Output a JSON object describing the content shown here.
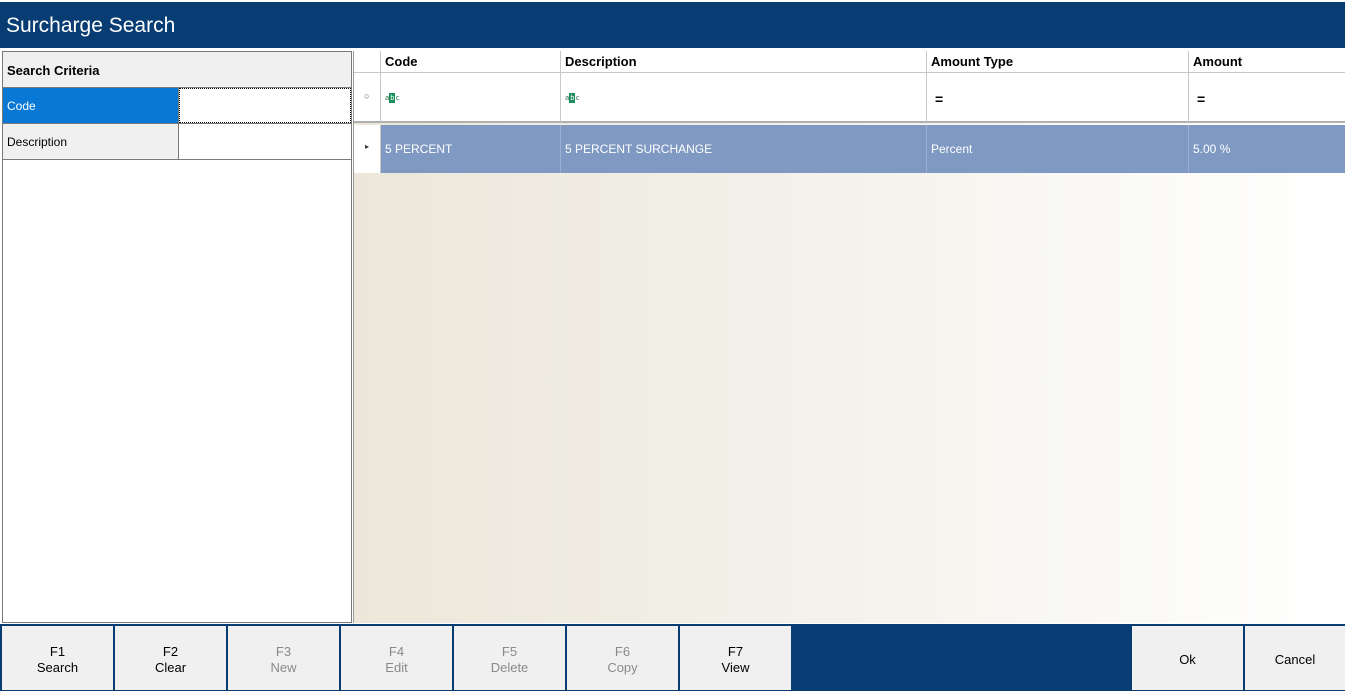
{
  "window": {
    "title": "Surcharge Search"
  },
  "criteria": {
    "header": "Search Criteria",
    "fields": [
      {
        "label": "Code",
        "value": ""
      },
      {
        "label": "Description",
        "value": ""
      }
    ]
  },
  "grid": {
    "columns": [
      "Code",
      "Description",
      "Amount Type",
      "Amount"
    ],
    "filter_icons": [
      "abc-text-filter-icon",
      "abc-text-filter-icon",
      "equals-filter-icon",
      "equals-filter-icon"
    ],
    "filter_text": {
      "abc": "ABC",
      "eq": "=",
      "pin": "•"
    },
    "rows": [
      {
        "code": "5 PERCENT",
        "description": "5 PERCENT SURCHANGE",
        "amount_type": "Percent",
        "amount": "5.00 %"
      }
    ],
    "row_indicator": "▸"
  },
  "footer": {
    "buttons": [
      {
        "key": "F1",
        "label": "Search",
        "enabled": true
      },
      {
        "key": "F2",
        "label": "Clear",
        "enabled": true
      },
      {
        "key": "F3",
        "label": "New",
        "enabled": false
      },
      {
        "key": "F4",
        "label": "Edit",
        "enabled": false
      },
      {
        "key": "F5",
        "label": "Delete",
        "enabled": false
      },
      {
        "key": "F6",
        "label": "Copy",
        "enabled": false
      },
      {
        "key": "F7",
        "label": "View",
        "enabled": true
      }
    ],
    "ok": "Ok",
    "cancel": "Cancel"
  },
  "colors": {
    "titlebar": "#073d73",
    "selected_row": "#7f99c3",
    "selected_field": "#0978d5"
  }
}
